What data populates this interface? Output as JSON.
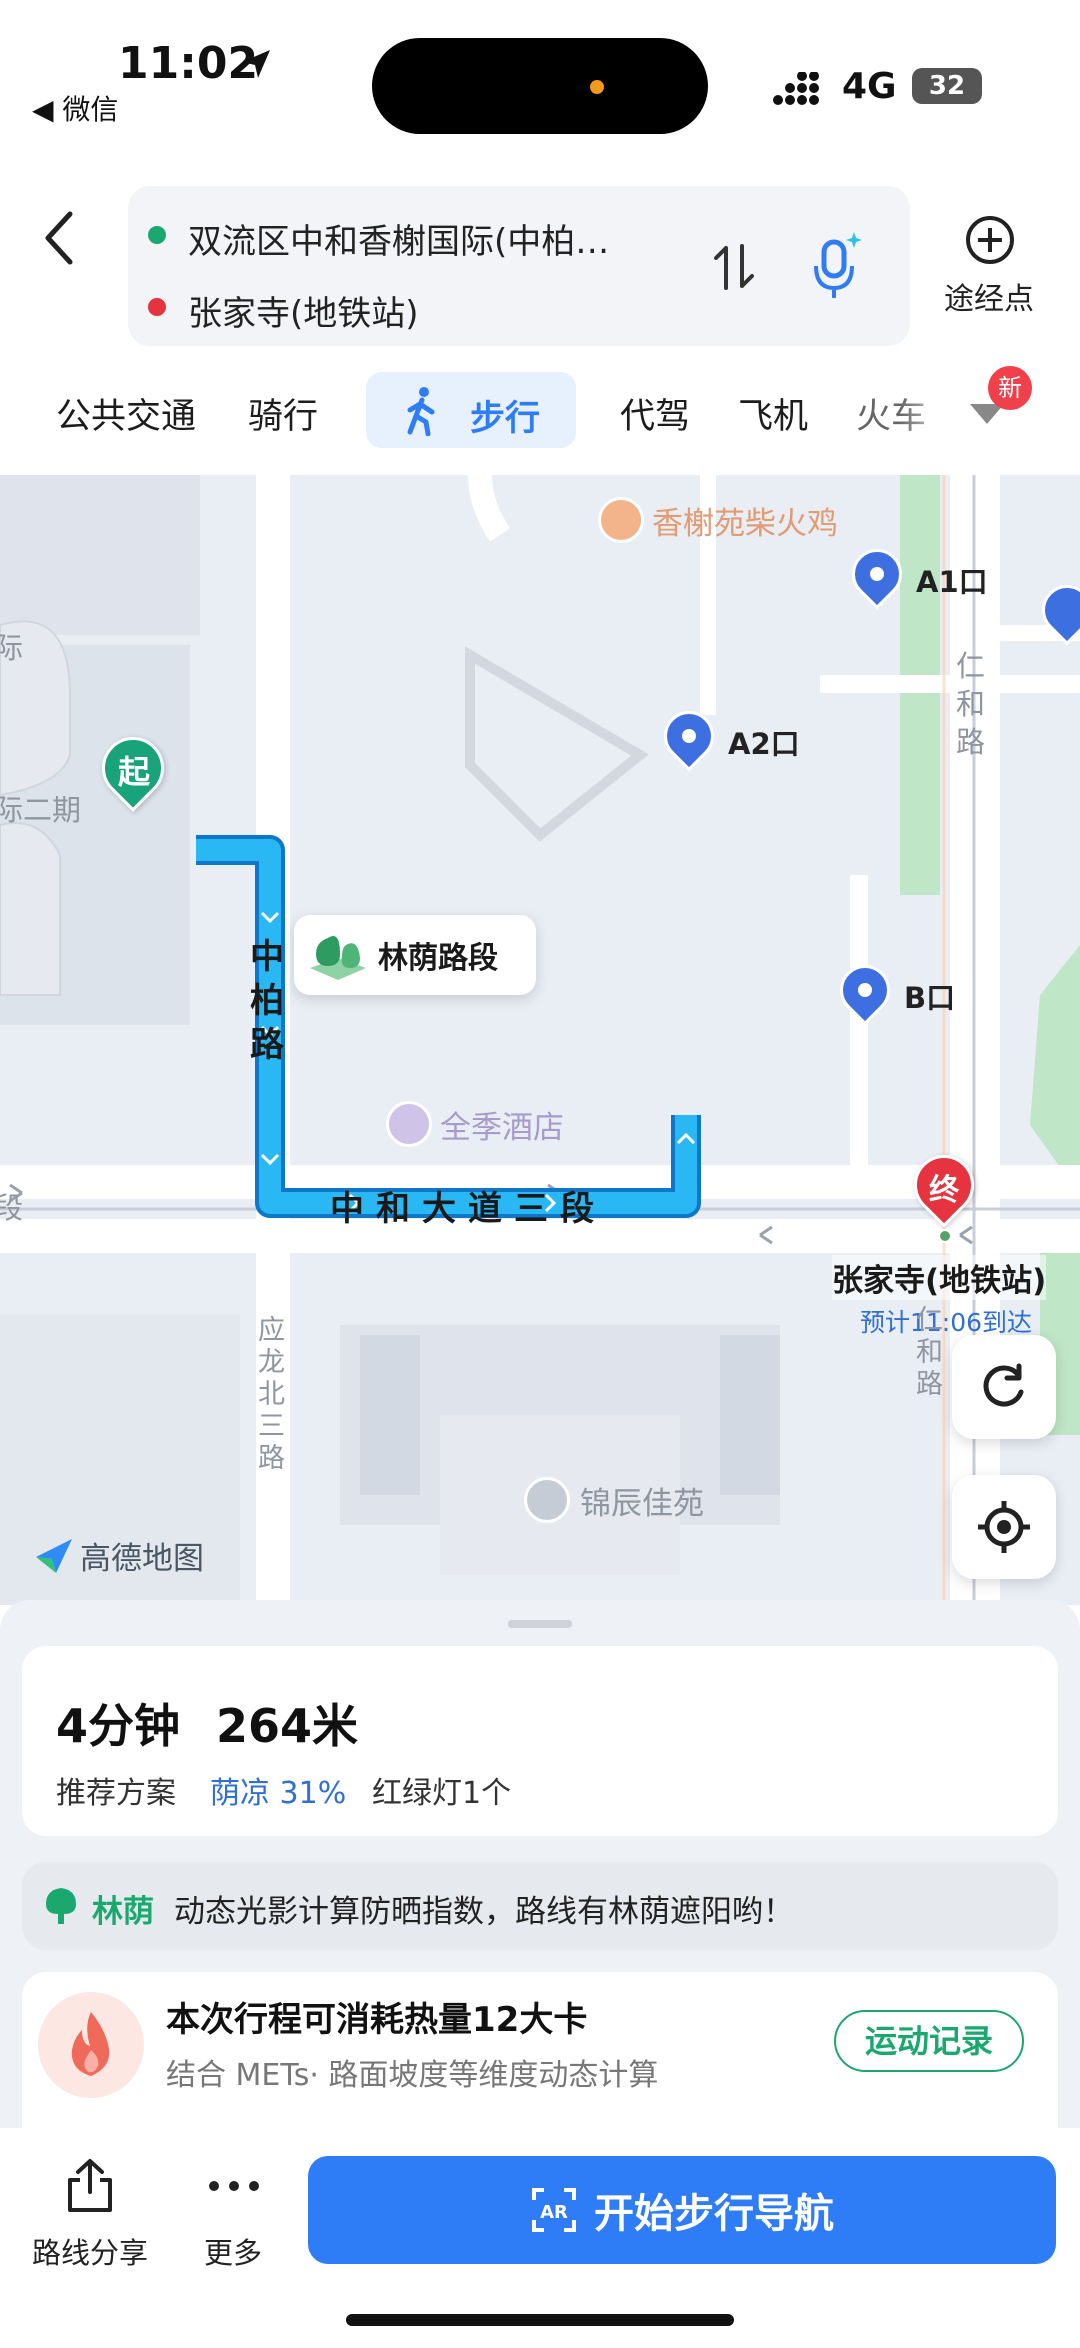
{
  "status_bar": {
    "time": "11:02",
    "back_app": "◀ 微信",
    "network": "4G",
    "battery": "32"
  },
  "route_input": {
    "origin": "双流区中和香榭国际(中柏…",
    "destination": "张家寺(地铁站)",
    "waypoint_label": "途经点"
  },
  "modes": {
    "tabs": [
      {
        "label": "公共交通"
      },
      {
        "label": "骑行"
      },
      {
        "label": "步行"
      },
      {
        "label": "代驾"
      },
      {
        "label": "飞机"
      },
      {
        "label": "火车"
      }
    ],
    "selected": "步行",
    "new_badge": "新"
  },
  "map": {
    "poi_top": "香榭苑柴火鸡",
    "street_renhe": "仁和路",
    "area_left": "际二期",
    "area_left_top": "际",
    "start_marker": "起",
    "street_zhongbai": "中柏路",
    "shade_label": "林荫路段",
    "hotel": "全季酒店",
    "exit_a1": "A1口",
    "exit_a2": "A2口",
    "exit_b": "B口",
    "avenue": "中和大道三段",
    "avenue_left": "段",
    "end_marker": "终",
    "destination_name": "张家寺(地铁站)",
    "eta": "预计11:06到达",
    "street_yinglong": "应龙北三路",
    "street_renhe2": "仁和路",
    "community": "锦辰佳苑",
    "logo": "高德地图"
  },
  "summary": {
    "duration": "4分钟",
    "distance": "264米",
    "recommend": "推荐方案",
    "shade": "荫凉 31%",
    "lights": "红绿灯1个"
  },
  "shade_tip": {
    "tag": "林荫",
    "text": "动态光影计算防晒指数，路线有林荫遮阳哟！"
  },
  "calorie": {
    "title": "本次行程可消耗热量12大卡",
    "subtitle": "结合 METs· 路面坡度等维度动态计算",
    "button": "运动记录"
  },
  "actions": {
    "share": "路线分享",
    "more": "更多",
    "start": "开始步行导航"
  },
  "colors": {
    "accent": "#2f7df6",
    "route": "#1aa6ee",
    "green": "#1aa86e",
    "red": "#e5343f"
  }
}
